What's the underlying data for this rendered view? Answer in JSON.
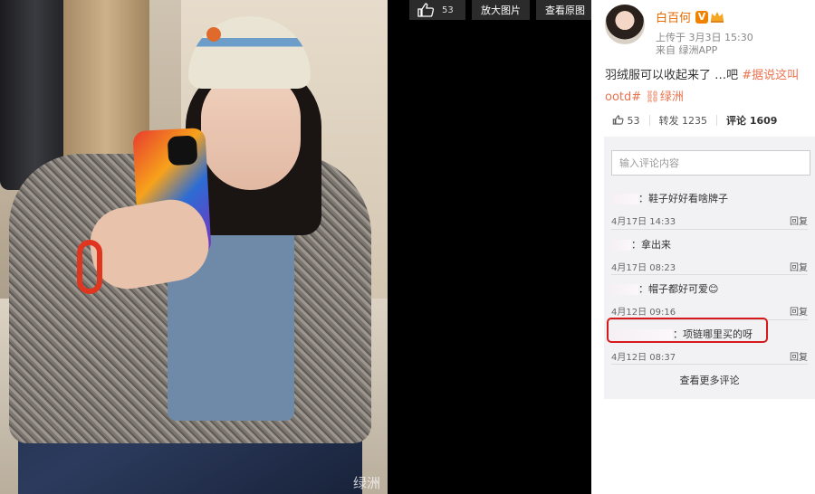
{
  "toolbar": {
    "like_count": "53",
    "enlarge_label": "放大图片",
    "original_label": "查看原图"
  },
  "photo": {
    "watermark": "绿洲"
  },
  "post": {
    "username": "白百何",
    "verified_badge": "V",
    "upload_time": "上传于 3月3日 15:30",
    "source": "来自 绿洲APP",
    "text_main": "羽绒服可以收起来了 …吧 ",
    "hashtag": "#据说这叫ootd#",
    "link_text": "绿洲"
  },
  "stats": {
    "likes": "53",
    "repost_label": "转发",
    "reposts": "1235",
    "comment_label": "评论",
    "comments": "1609"
  },
  "comments": {
    "input_placeholder": "输入评论内容",
    "reply_label": "回复",
    "items": [
      {
        "text": "：鞋子好好看啥牌子",
        "time": "4月17日 14:33"
      },
      {
        "text": "：拿出来",
        "time": "4月17日 08:23"
      },
      {
        "text": "：帽子都好可爱😊",
        "time": "4月12日 09:16"
      },
      {
        "text": "：项链哪里买的呀",
        "time": "4月12日 08:37"
      }
    ],
    "more_label": "查看更多评论"
  },
  "colors": {
    "accent_orange": "#eb7350",
    "username_orange": "#e86a00",
    "highlight_red": "#d6191b"
  }
}
